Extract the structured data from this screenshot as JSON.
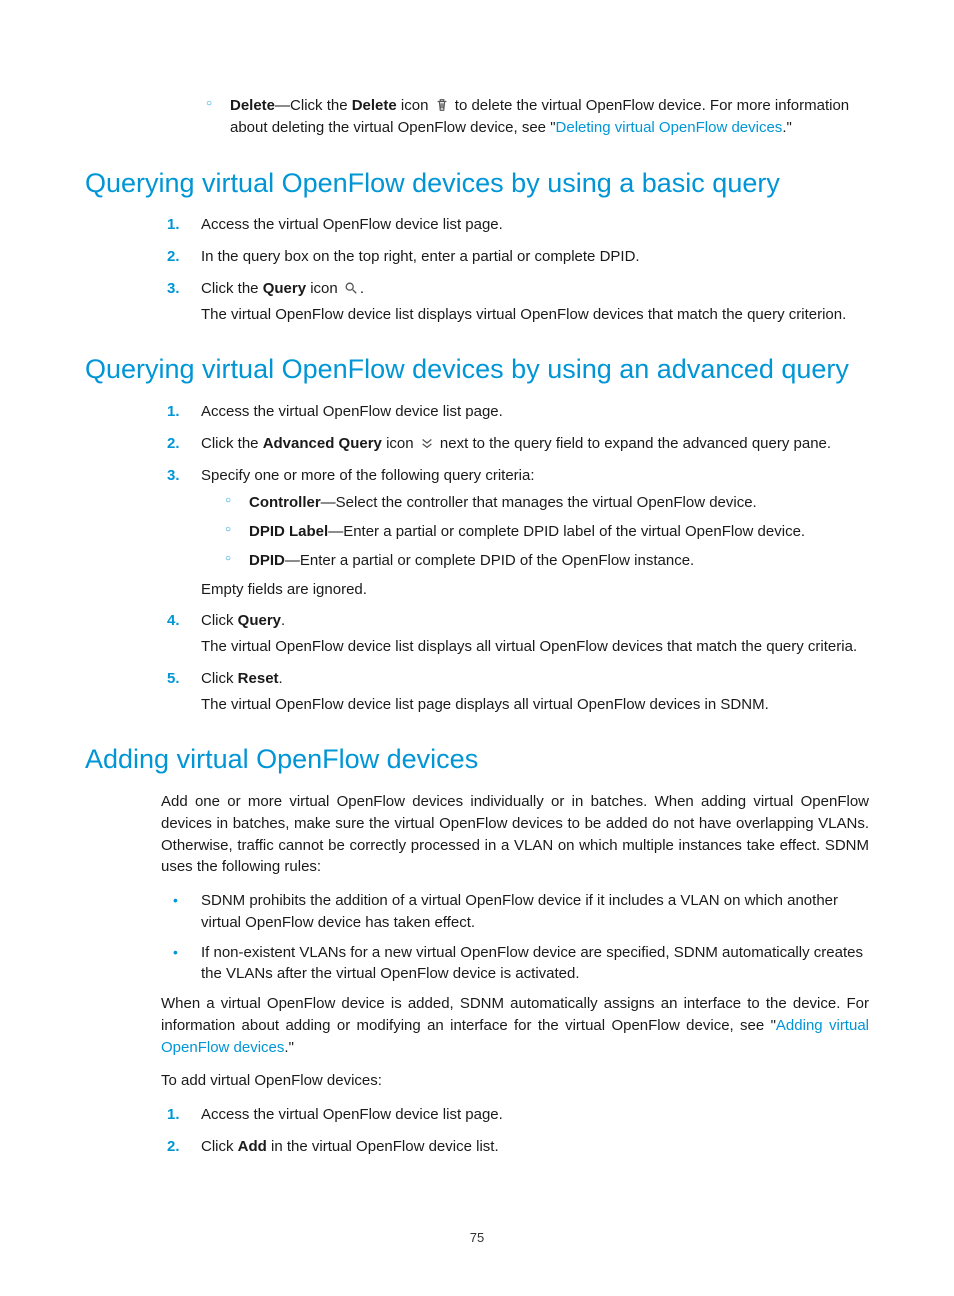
{
  "pageNumber": "75",
  "top": {
    "delete_bold": "Delete",
    "delete_text_a": "—Click the ",
    "delete_bold2": "Delete",
    "delete_text_b": " icon ",
    "delete_text_c": " to delete the virtual OpenFlow device. For more information about deleting the virtual OpenFlow device, see \"",
    "delete_link": "Deleting virtual OpenFlow devices",
    "delete_text_d": ".\""
  },
  "h1": "Querying virtual OpenFlow devices by using a basic query",
  "s1": {
    "i1": "Access the virtual OpenFlow device list page.",
    "i2": "In the query box on the top right, enter a partial or complete DPID.",
    "i3a": "Click the ",
    "i3b": "Query",
    "i3c": " icon ",
    "i3d": ".",
    "i3f": "The virtual OpenFlow device list displays virtual OpenFlow devices that match the query criterion."
  },
  "h2": "Querying virtual OpenFlow devices by using an advanced query",
  "s2": {
    "i1": "Access the virtual OpenFlow device list page.",
    "i2a": "Click the ",
    "i2b": "Advanced Query",
    "i2c": " icon ",
    "i2d": " next to the query field to expand the advanced query pane.",
    "i3": "Specify one or more of the following query criteria:",
    "sub1b": "Controller",
    "sub1t": "—Select the controller that manages the virtual OpenFlow device.",
    "sub2b": "DPID Label",
    "sub2t": "—Enter a partial or complete DPID label of the virtual OpenFlow device.",
    "sub3b": "DPID",
    "sub3t": "—Enter a partial or complete DPID of the OpenFlow instance.",
    "empty": "Empty fields are ignored.",
    "i4a": "Click ",
    "i4b": "Query",
    "i4c": ".",
    "i4f": "The virtual OpenFlow device list displays all virtual OpenFlow devices that match the query criteria.",
    "i5a": "Click ",
    "i5b": "Reset",
    "i5c": ".",
    "i5f": "The virtual OpenFlow device list page displays all virtual OpenFlow devices in SDNM."
  },
  "h3": "Adding virtual OpenFlow devices",
  "s3": {
    "p1": "Add one or more virtual OpenFlow devices individually or in batches. When adding virtual OpenFlow devices in batches, make sure the virtual OpenFlow devices to be added do not have overlapping VLANs. Otherwise, traffic cannot be correctly processed in a VLAN on which multiple instances take effect. SDNM uses the following rules:",
    "b1": "SDNM prohibits the addition of a virtual OpenFlow device if it includes a VLAN on which another virtual OpenFlow device has taken effect.",
    "b2": "If non-existent VLANs for a new virtual OpenFlow device are specified, SDNM automatically creates the VLANs after the virtual OpenFlow device is activated.",
    "p2a": "When a virtual OpenFlow device is added, SDNM automatically assigns an interface to the device. For information about adding or modifying an interface for the virtual OpenFlow device, see \"",
    "p2link": "Adding virtual OpenFlow devices",
    "p2b": ".\"",
    "p3": "To add virtual OpenFlow devices:",
    "i1": "Access the virtual OpenFlow device list page.",
    "i2a": "Click ",
    "i2b": "Add",
    "i2c": " in the virtual OpenFlow device list."
  }
}
